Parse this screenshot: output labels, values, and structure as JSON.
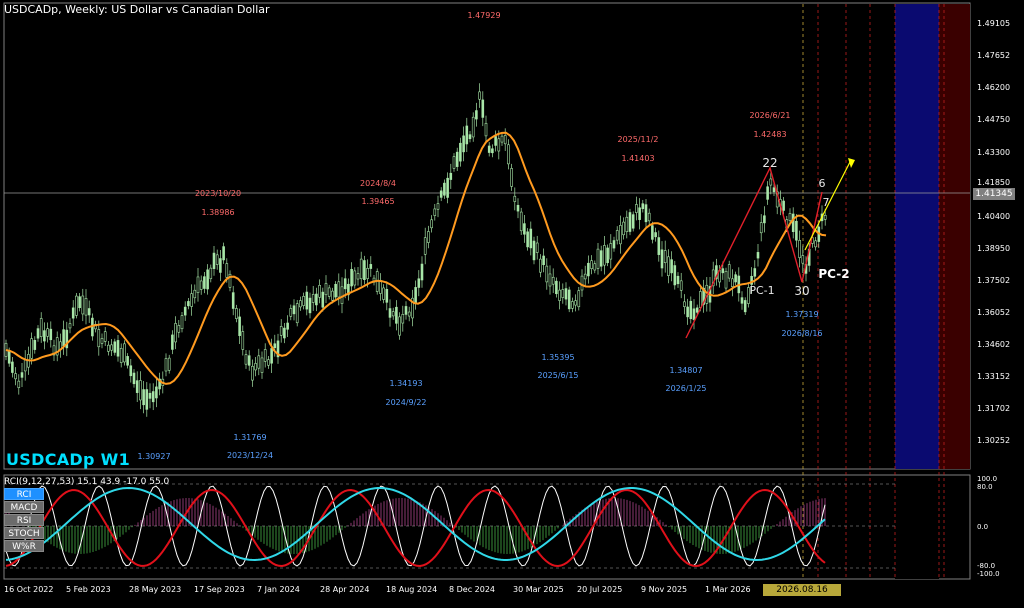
{
  "header": {
    "symbol_title": "USDCADp, Weekly:  US Dollar vs Canadian Dollar"
  },
  "symbol_label": "USDCADp W1",
  "current_price": "1.41345",
  "price_axis": [
    "1.49105",
    "1.47652",
    "1.46200",
    "1.44750",
    "1.43300",
    "1.41850",
    "1.40400",
    "1.38950",
    "1.37502",
    "1.36052",
    "1.34602",
    "1.33152",
    "1.31702",
    "1.30252"
  ],
  "time_axis": [
    "16 Oct 2022",
    "5 Feb 2023",
    "28 May 2023",
    "17 Sep 2023",
    "7 Jan 2024",
    "28 Apr 2024",
    "18 Aug 2024",
    "8 Dec 2024",
    "30 Mar 2025",
    "20 Jul 2025",
    "9 Nov 2025",
    "1 Mar 2026",
    "2026.08.16 00:00"
  ],
  "highs": [
    {
      "price": "1.38986",
      "date": "2023/10/20"
    },
    {
      "price": "1.39465",
      "date": "2024/8/4"
    },
    {
      "price": "1.47929",
      "date": ""
    },
    {
      "price": "1.41403",
      "date": "2025/11/2"
    },
    {
      "price": "1.42483",
      "date": "2026/6/21"
    }
  ],
  "lows": [
    {
      "price": "1.30927",
      "date": ""
    },
    {
      "price": "1.31769",
      "date": "2023/12/24"
    },
    {
      "price": "1.34193",
      "date": "2024/9/22"
    },
    {
      "price": "1.35395",
      "date": "2025/6/15"
    },
    {
      "price": "1.34807",
      "date": "2026/1/25"
    },
    {
      "price": "1.37319",
      "date": "2026/8/16"
    }
  ],
  "wave_labels": {
    "p22": "22",
    "p30": "30",
    "p6": "6",
    "p7": "7",
    "pc1": "PC-1",
    "pc2": "PC-2"
  },
  "oscillator": {
    "header": "RCI(9,12,27,53) 15.1 43.9 -17.0 55.0",
    "buttons": [
      "RCI",
      "MACD",
      "RSI",
      "STOCH",
      "W%R"
    ],
    "levels": [
      "100.0",
      "80.0",
      "0.0",
      "-80.0",
      "-100.0"
    ]
  },
  "colors": {
    "bull": "#a8e6a8",
    "ma": "#ff9a1f",
    "zigzag": "#e0202a",
    "high_label": "#ff6b6b",
    "low_label": "#5aa0ff",
    "forecast": "#ffff00",
    "zone": "#0a0a70"
  }
}
